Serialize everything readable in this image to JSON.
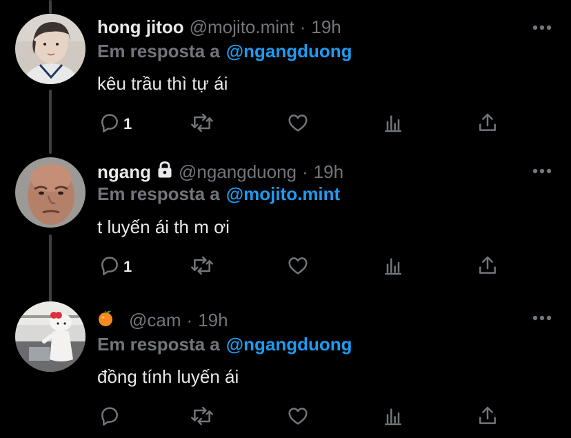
{
  "colors": {
    "background": "#000000",
    "primary_text": "#e7e9ea",
    "secondary_text": "#71767b",
    "mention": "#1d9bf0"
  },
  "tweets": [
    {
      "display_name": "hong jitoo",
      "handle": "@mojito.mint",
      "separator": "·",
      "time": "19h",
      "reply_prefix": "Em resposta a",
      "reply_to": "@ngangduong",
      "text": "kêu trầu thì tự ái",
      "reply_count": "1",
      "icons": [
        "reply-icon",
        "retweet-icon",
        "like-icon",
        "analytics-icon",
        "share-icon",
        "more-icon"
      ]
    },
    {
      "display_name": "ngang",
      "protected": true,
      "handle": "@ngangduong",
      "separator": "·",
      "time": "19h",
      "reply_prefix": "Em resposta a",
      "reply_to": "@mojito.mint",
      "text": "t luyến ái th m ơi",
      "reply_count": "1",
      "icons": [
        "lock-icon",
        "reply-icon",
        "retweet-icon",
        "like-icon",
        "analytics-icon",
        "share-icon",
        "more-icon"
      ]
    },
    {
      "display_name": "",
      "name_emoji": "tangerine-emoji",
      "handle": "@cam",
      "separator": "·",
      "time": "19h",
      "reply_prefix": "Em resposta a",
      "reply_to": "@ngangduong",
      "text": "đồng tính luyến ái",
      "reply_count": "",
      "icons": [
        "reply-icon",
        "retweet-icon",
        "like-icon",
        "analytics-icon",
        "share-icon",
        "more-icon"
      ]
    }
  ]
}
